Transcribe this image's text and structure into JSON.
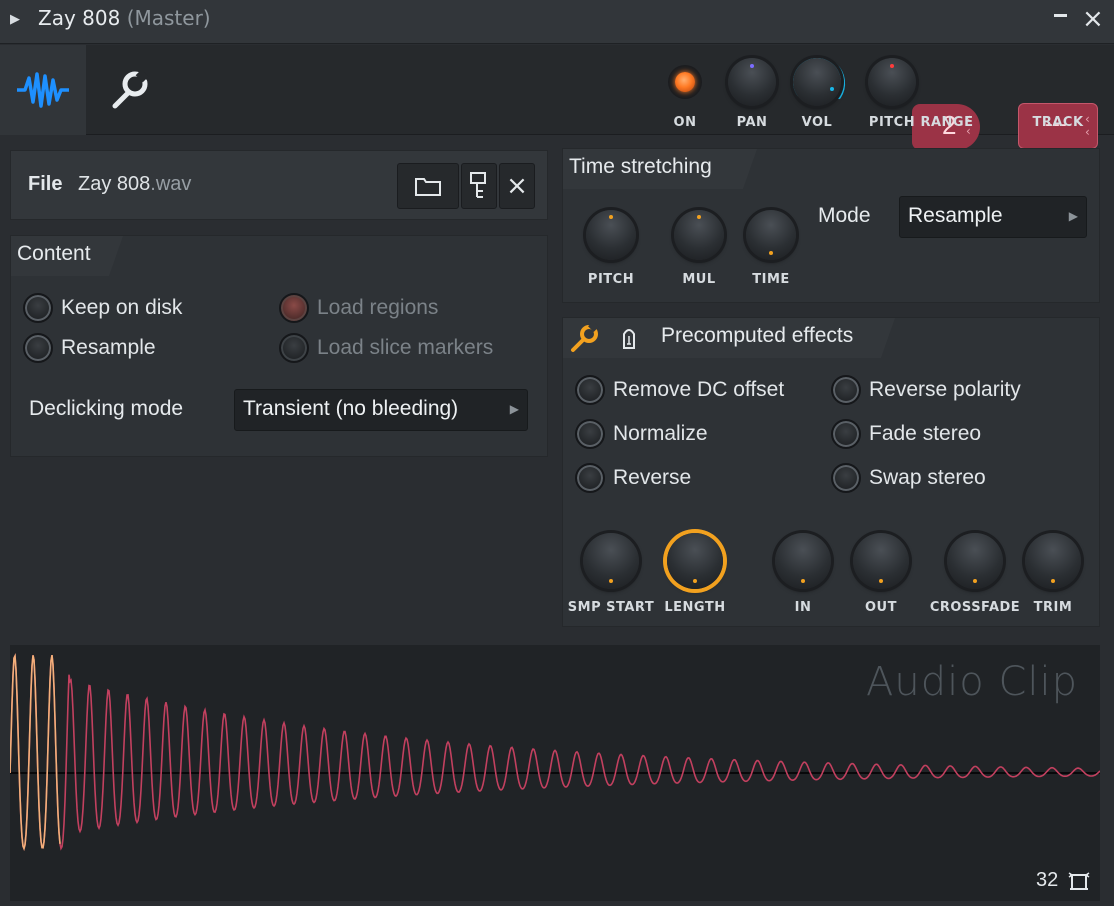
{
  "window": {
    "title": "Zay 808",
    "subtitle": "(Master)"
  },
  "toolbar": {
    "on_label": "ON",
    "pan_label": "PAN",
    "vol_label": "VOL",
    "pitch_label": "PITCH",
    "range_label": "RANGE",
    "range_value": "2",
    "track_label": "TRACK",
    "track_value": "---",
    "colors": {
      "active_tab_icon": "#1e90ff",
      "vol_ring": "#19b7e8",
      "range_box": "#9b3346",
      "on_led": "#ff7a24"
    }
  },
  "file": {
    "label": "File",
    "name": "Zay 808",
    "ext": ".wav"
  },
  "content": {
    "title": "Content",
    "options": [
      {
        "label": "Keep on disk",
        "enabled": true
      },
      {
        "label": "Resample",
        "enabled": true
      },
      {
        "label": "Load regions",
        "enabled": false
      },
      {
        "label": "Load slice markers",
        "enabled": false
      }
    ],
    "declicking_label": "Declicking mode",
    "declicking_value": "Transient (no bleeding)"
  },
  "time_stretching": {
    "title": "Time stretching",
    "knobs": [
      "PITCH",
      "MUL",
      "TIME"
    ],
    "mode_label": "Mode",
    "mode_value": "Resample"
  },
  "precomputed": {
    "title": "Precomputed effects",
    "options": [
      "Remove DC offset",
      "Reverse polarity",
      "Normalize",
      "Fade stereo",
      "Reverse",
      "Swap stereo"
    ],
    "knobs": [
      "SMP START",
      "LENGTH",
      "IN",
      "OUT",
      "CROSSFADE",
      "TRIM"
    ],
    "accent": "#f2a11f"
  },
  "waveform": {
    "title": "Audio Clip",
    "zoom": "32",
    "color": "#c2405f"
  }
}
